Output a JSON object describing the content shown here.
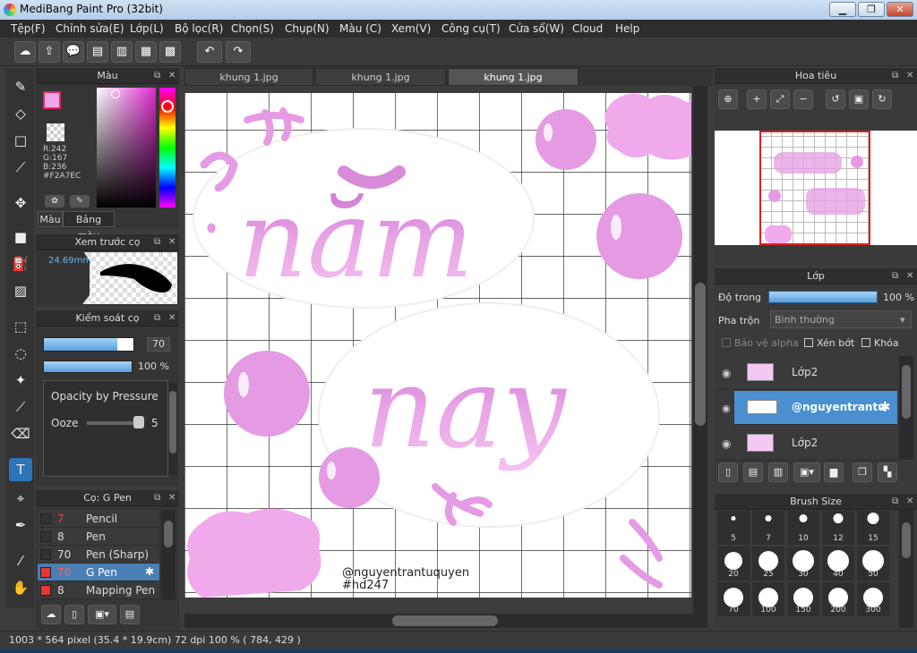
{
  "window": {
    "title": "MediBang Paint Pro (32bit)"
  },
  "menu": [
    "Tệp(F)",
    "Chỉnh sửa(E)",
    "Lớp(L)",
    "Bộ lọc(R)",
    "Chọn(S)",
    "Chụp(N)",
    "Màu (C)",
    "Xem(V)",
    "Công cụ(T)",
    "Cửa sổ(W)",
    "Cloud",
    "Help"
  ],
  "color_panel": {
    "title": "Màu",
    "r": "R:242",
    "g": "G:167",
    "b": "B:236",
    "hex": "#F2A7EC",
    "tab_color": "Màu",
    "tab_palette": "Bảng màu",
    "current_color": "#F2A7EC"
  },
  "brush_preview": {
    "title": "Xem trước cọ",
    "size": "24.69mm"
  },
  "brush_control": {
    "title": "Kiểm soát cọ",
    "size": "70",
    "opacity": "100 %",
    "opacity_pressure": "Opacity by Pressure",
    "ooze": "Ooze",
    "ooze_value": "5"
  },
  "brush_list": {
    "title": "Cọ: G Pen",
    "items": [
      {
        "size": "7",
        "name": "Pencil",
        "color": "#333333"
      },
      {
        "size": "8",
        "name": "Pen",
        "color": "#333333"
      },
      {
        "size": "70",
        "name": "Pen (Sharp)",
        "color": "#333333"
      },
      {
        "size": "70",
        "name": "G Pen",
        "color": "#e83535"
      },
      {
        "size": "8",
        "name": "Mapping Pen",
        "color": "#e83535"
      }
    ]
  },
  "tabs": [
    "khung 1.jpg",
    "khung 1.jpg",
    "khung 1.jpg"
  ],
  "canvas": {
    "text_main1": "năm",
    "text_main2": "nay",
    "watermark1": "@nguyentrantuquyen",
    "watermark2": "#hd247",
    "accent": "#e59be4"
  },
  "navigator": {
    "title": "Hoa tiêu"
  },
  "layer_panel": {
    "title": "Lớp",
    "opacity_label": "Độ trong",
    "opacity_value": "100 %",
    "blend_label": "Pha trộn",
    "blend_value": "Bình thường",
    "protect_alpha": "Bảo vệ alpha",
    "clipping": "Xén bớt",
    "lock": "Khóa",
    "layers": [
      {
        "name": "Lớp2"
      },
      {
        "name": "@nguyentrantu"
      },
      {
        "name": "Lớp2"
      }
    ]
  },
  "brush_size": {
    "title": "Brush Size",
    "sizes": [
      "5",
      "7",
      "10",
      "12",
      "15",
      "20",
      "25",
      "30",
      "40",
      "50",
      "70",
      "100",
      "150",
      "200",
      "300"
    ]
  },
  "status": {
    "text": "1003 * 564 pixel   (35.4 * 19.9cm)   72 dpi   100 %   ( 784, 429 )"
  }
}
